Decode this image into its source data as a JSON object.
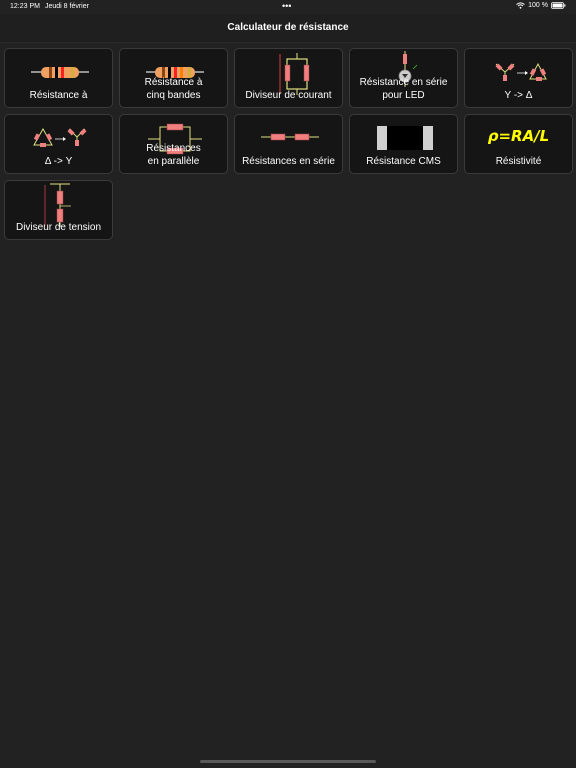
{
  "status_bar": {
    "time": "12:23 PM",
    "date": "Jeudi 8 février",
    "dots": "•••",
    "battery": "100 %"
  },
  "header": {
    "title": "Calculateur de résistance"
  },
  "tiles": [
    {
      "label": "Résistance à",
      "icon": "resistor-4band-icon"
    },
    {
      "label": "Résistance à\ncinq bandes",
      "icon": "resistor-5band-icon"
    },
    {
      "label": "Diviseur de courant",
      "icon": "current-divider-icon"
    },
    {
      "label": "Résistance en série\npour LED",
      "icon": "led-resistor-icon"
    },
    {
      "label": "Y -> Δ",
      "icon": "wye-delta-icon"
    },
    {
      "label": "Δ -> Y",
      "icon": "delta-wye-icon"
    },
    {
      "label": "Résistances\nen parallèle",
      "icon": "parallel-resistors-icon"
    },
    {
      "label": "Résistances en série",
      "icon": "series-resistors-icon"
    },
    {
      "label": "Résistance CMS",
      "icon": "smd-resistor-icon"
    },
    {
      "label": "Résistivité",
      "icon": "resistivity-formula-icon",
      "formula": "ρ=RA/L",
      "formula_color": "#ffff00"
    },
    {
      "label": "Diviseur de tension",
      "icon": "voltage-divider-icon"
    }
  ],
  "colors": {
    "background": "#222222",
    "tile": "#151515",
    "resistor_body": "#f0a060",
    "resistor_pink": "#f08080",
    "wire": "#e0e080"
  }
}
